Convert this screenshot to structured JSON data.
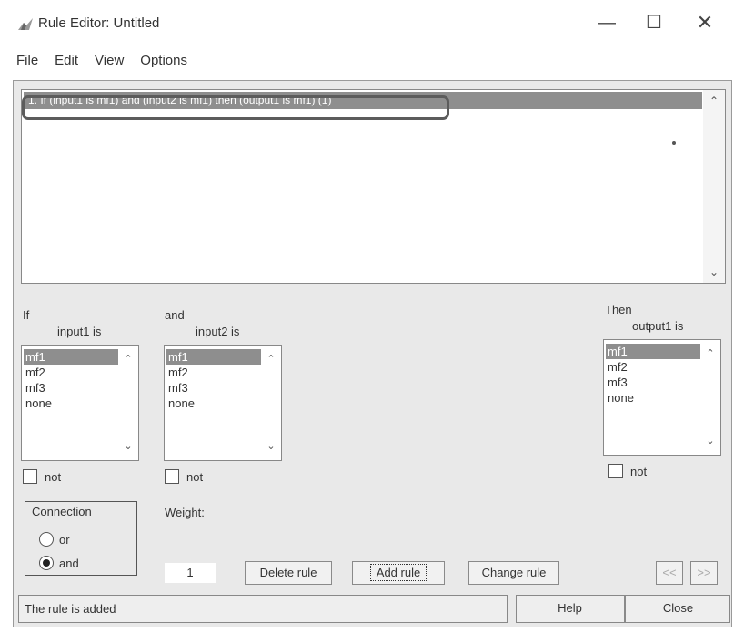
{
  "window": {
    "title": "Rule Editor: Untitled"
  },
  "menu": [
    "File",
    "Edit",
    "View",
    "Options"
  ],
  "rules": [
    "1. If (input1 is mf1) and (input2 is mf1) then (output1 is mf1) (1)"
  ],
  "if_column": {
    "header": "If",
    "variable_label": "input1 is",
    "options": [
      "mf1",
      "mf2",
      "mf3",
      "none"
    ],
    "selected": "mf1",
    "not_label": "not"
  },
  "and_column": {
    "header": "and",
    "variable_label": "input2 is",
    "options": [
      "mf1",
      "mf2",
      "mf3",
      "none"
    ],
    "selected": "mf1",
    "not_label": "not"
  },
  "then_column": {
    "header": "Then",
    "variable_label": "output1 is",
    "options": [
      "mf1",
      "mf2",
      "mf3",
      "none"
    ],
    "selected": "mf1",
    "not_label": "not"
  },
  "connection": {
    "title": "Connection",
    "options": [
      "or",
      "and"
    ],
    "selected": "and"
  },
  "weight": {
    "label": "Weight:",
    "value": "1"
  },
  "buttons": {
    "delete_rule": "Delete rule",
    "add_rule": "Add rule",
    "change_rule": "Change rule",
    "prev": "<<",
    "next": ">>",
    "help": "Help",
    "close": "Close"
  },
  "status": "The rule is added",
  "colors": {
    "selection": "#8e8e8e",
    "panel": "#e9e9e9"
  }
}
